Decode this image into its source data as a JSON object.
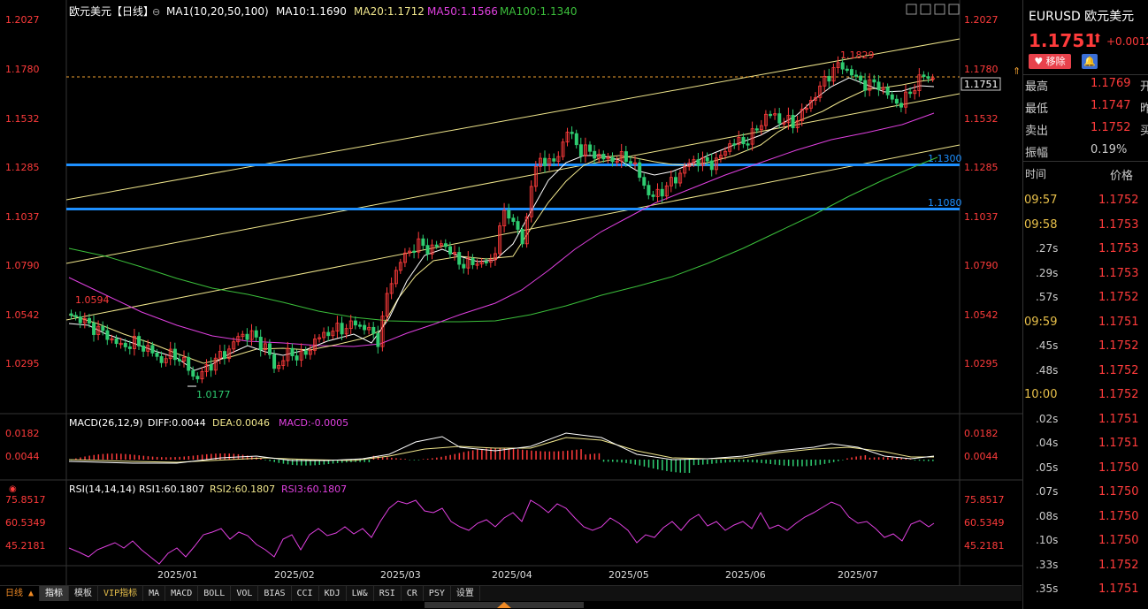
{
  "header": {
    "title": "欧元美元【日线】",
    "ma_label": "MA1(10,20,50,100)",
    "ma10": "MA10:1.1690",
    "ma20": "MA20:1.1712",
    "ma50": "MA50:1.1566",
    "ma100": "MA100:1.1340"
  },
  "price_axis": [
    "1.2027",
    "1.1780",
    "1.1532",
    "1.1285",
    "1.1037",
    "1.0790",
    "1.0542",
    "1.0295"
  ],
  "current_price_tag": "1.1751",
  "annotations": {
    "high": "1.1829",
    "low": "1.0177",
    "left_high": "1.0594",
    "level_upper": "1.1300",
    "level_lower": "1.1080"
  },
  "macd": {
    "label": "MACD(26,12,9)",
    "diff": "DIFF:0.0044",
    "dea": "DEA:0.0046",
    "macd": "MACD:-0.0005",
    "axis": [
      "0.0182",
      "0.0044"
    ]
  },
  "rsi": {
    "label": "RSI(14,14,14)",
    "rsi1": "RSI1:60.1807",
    "rsi2": "RSI2:60.1807",
    "rsi3": "RSI3:60.1807",
    "axis": [
      "75.8517",
      "60.5349",
      "45.2181"
    ]
  },
  "date_axis": [
    "2025/01",
    "2025/02",
    "2025/03",
    "2025/04",
    "2025/05",
    "2025/06",
    "2025/07"
  ],
  "period_label": "日线",
  "tabs": [
    "指标",
    "模板",
    "VIP指标",
    "MA",
    "MACD",
    "BOLL",
    "VOL",
    "BIAS",
    "CCI",
    "KDJ",
    "LW&",
    "RSI",
    "CR",
    "PSY",
    "设置"
  ],
  "quote": {
    "symbol": "EURUSD 欧元美元",
    "price": "1.1751",
    "change": "+0.0012",
    "remove_btn": "移除",
    "rows": [
      {
        "k": "最高",
        "v": "1.1769",
        "s": "开"
      },
      {
        "k": "最低",
        "v": "1.1747",
        "s": "昨"
      },
      {
        "k": "卖出",
        "v": "1.1752",
        "s": "买"
      },
      {
        "k": "振幅",
        "v": "0.19%",
        "s": ""
      }
    ],
    "ticks_header": {
      "time": "时间",
      "price": "价格"
    },
    "ticks": [
      {
        "t": "09:57",
        "p": "1.1752"
      },
      {
        "t": "09:58",
        "p": "1.1753"
      },
      {
        "t": ".27s",
        "p": "1.1753"
      },
      {
        "t": ".29s",
        "p": "1.1753"
      },
      {
        "t": ".57s",
        "p": "1.1752"
      },
      {
        "t": "09:59",
        "p": "1.1751"
      },
      {
        "t": ".45s",
        "p": "1.1752"
      },
      {
        "t": ".48s",
        "p": "1.1752"
      },
      {
        "t": "10:00",
        "p": "1.1752"
      },
      {
        "t": ".02s",
        "p": "1.1751"
      },
      {
        "t": ".04s",
        "p": "1.1751"
      },
      {
        "t": ".05s",
        "p": "1.1750"
      },
      {
        "t": ".07s",
        "p": "1.1750"
      },
      {
        "t": ".08s",
        "p": "1.1750"
      },
      {
        "t": ".10s",
        "p": "1.1750"
      },
      {
        "t": ".33s",
        "p": "1.1752"
      },
      {
        "t": ".35s",
        "p": "1.1751"
      }
    ]
  },
  "colors": {
    "up": "#ff3b3b",
    "down": "#2ecc71",
    "ma10": "#ffffff",
    "ma20": "#f0e68c",
    "ma50": "#e040e0",
    "ma100": "#3bbf3b",
    "level": "#1e90ff"
  }
}
